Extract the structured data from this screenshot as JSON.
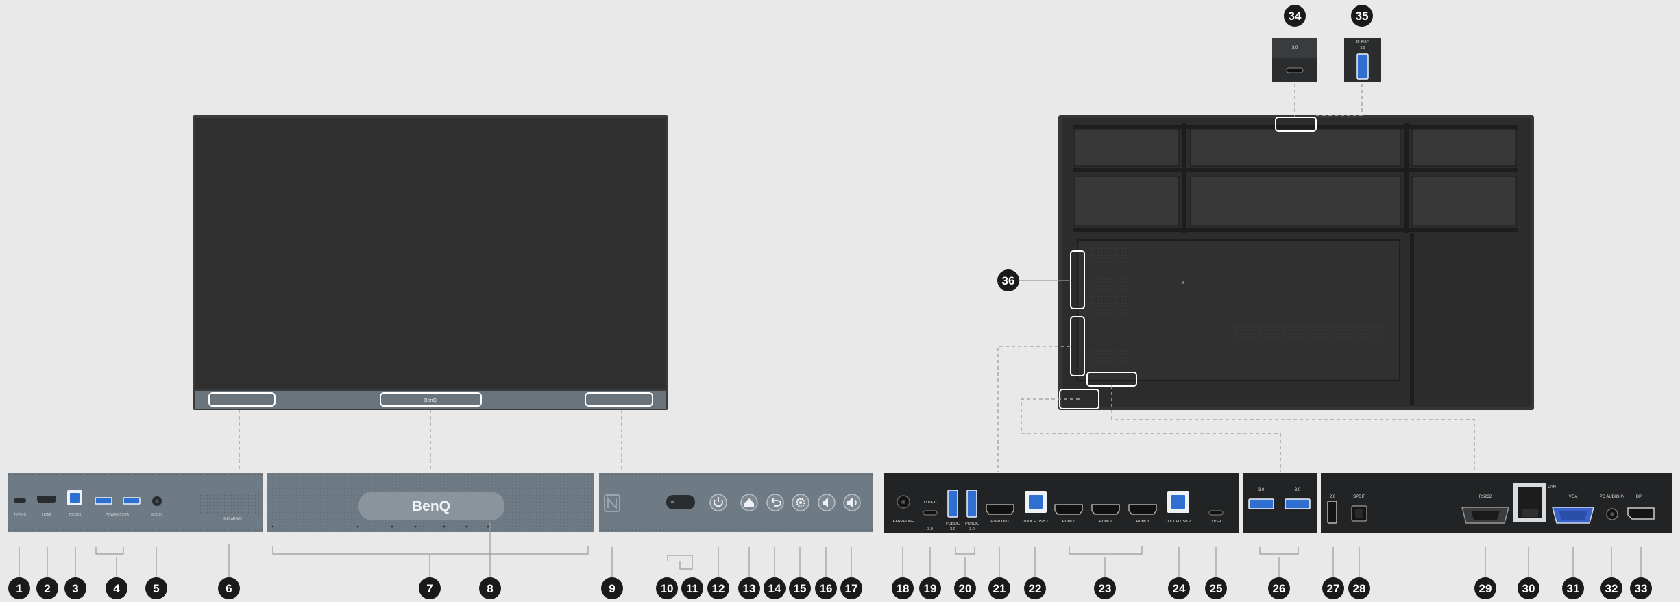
{
  "callouts": [
    "1",
    "2",
    "3",
    "4",
    "5",
    "6",
    "7",
    "8",
    "9",
    "10",
    "11",
    "12",
    "13",
    "14",
    "15",
    "16",
    "17",
    "18",
    "19",
    "20",
    "21",
    "22",
    "23",
    "24",
    "25",
    "26",
    "27",
    "28",
    "29",
    "30",
    "31",
    "32",
    "33",
    "34",
    "35",
    "36"
  ],
  "bezel": {
    "logo": "BenQ",
    "small_logo": "BenQ",
    "left_ports": [
      "TYPE-C",
      "HDMI",
      "TOUCH",
      "POWER 5V/2A",
      "MIC IN"
    ],
    "speaker_label": "MIC ARRAY",
    "buttons": [
      "power-icon",
      "home-icon",
      "back-icon",
      "settings-icon",
      "volume-down-icon",
      "volume-up-icon"
    ]
  },
  "bottom_panel": {
    "ports": [
      "EARPHONE",
      "TYPE-C 3.0",
      "PUBLIC 3.0",
      "PUBLIC 3.0",
      "HDMI OUT",
      "TOUCH USB 1",
      "HDMI 1",
      "HDMI 2",
      "HDMI 3",
      "TOUCH USB 2",
      "TYPE-C"
    ]
  },
  "usb_panel": {
    "labels": [
      "3.0",
      "3.0"
    ]
  },
  "side_panel": {
    "labels": [
      "2.0",
      "SPDIF",
      "RS232",
      "LAN",
      "VGA",
      "PC AUDIO-IN",
      "DP"
    ]
  },
  "top_ports": [
    {
      "label": "3.0"
    },
    {
      "label": "PUBLIC 3.0"
    }
  ],
  "colors": {
    "background": "#e9e9e9",
    "display_frame": "#3a3b3c",
    "display_screen": "#2f2f2f",
    "bezel": "#6e7a84",
    "panel_dark": "#222324",
    "callout_fill": "#1a1a1a",
    "callout_text": "#ffffff",
    "usb_blue": "#2f6fd1",
    "vga_blue": "#3a63c9"
  }
}
